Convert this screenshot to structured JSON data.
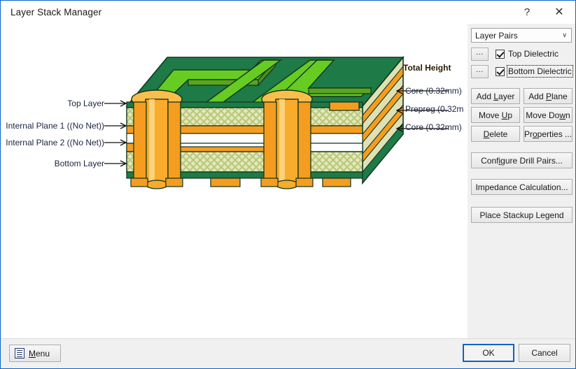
{
  "window": {
    "title": "Layer Stack Manager",
    "help_icon": "?",
    "close_icon": "✕"
  },
  "diagram": {
    "left_labels": [
      {
        "text": "Top Layer",
        "arrow": "→"
      },
      {
        "text": "Internal Plane 1 ((No Net))",
        "arrow": "→"
      },
      {
        "text": "Internal Plane 2 ((No Net))",
        "arrow": "→"
      },
      {
        "text": "Bottom Layer",
        "arrow": "→"
      }
    ],
    "right_labels": [
      {
        "text": "Total Height"
      },
      {
        "text": "Core (0.32mm)"
      },
      {
        "text": "Prepreg (0.32m"
      },
      {
        "text": "Core (0.32mm)"
      }
    ],
    "colors": {
      "solder_mask": "#1e7a46",
      "solder_mask_dark": "#17603a",
      "trace": "#66cc22",
      "trace_side": "#4a9018",
      "trace_top_dark": "#5aa520",
      "copper": "#f59d1e",
      "copper_light": "#fcbe4b",
      "copper_dark": "#e07d00",
      "dielectric": "#e4e8be",
      "dielectric_side": "#dfe1b4",
      "hatch": "#b9c97a",
      "outline": "#1a3a2a"
    }
  },
  "panel": {
    "combo": {
      "value": "Layer Pairs",
      "chevron_icon": "∨"
    },
    "dielectrics": [
      {
        "browse_label": "...",
        "label": "Top Dielectric",
        "checked": true,
        "focused": false
      },
      {
        "browse_label": "...",
        "label": "Bottom Dielectric",
        "checked": true,
        "focused": true
      }
    ],
    "buttons": [
      {
        "label": "Add Layer",
        "mnemonic": "L"
      },
      {
        "label": "Add Plane",
        "mnemonic": "P"
      },
      {
        "label": "Move Up",
        "mnemonic": "U"
      },
      {
        "label": "Move Down",
        "mnemonic": "w"
      },
      {
        "label": "Delete",
        "mnemonic": "D"
      },
      {
        "label": "Properties ...",
        "mnemonic": "o"
      },
      {
        "label": "Configure Drill Pairs...",
        "mnemonic": "i"
      },
      {
        "label": "Impedance Calculation...",
        "mnemonic": ""
      },
      {
        "label": "Place Stackup Legend",
        "mnemonic": ""
      }
    ]
  },
  "footer": {
    "menu_label": "Menu",
    "menu_mnemonic": "M",
    "ok_label": "OK",
    "cancel_label": "Cancel"
  }
}
